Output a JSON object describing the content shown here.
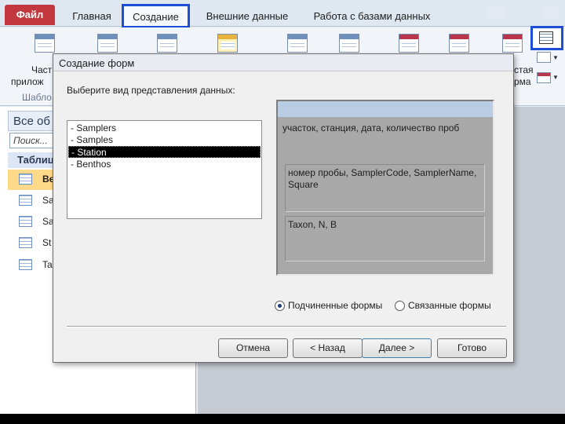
{
  "ribbon_tabs": {
    "file": "Файл",
    "home": "Главная",
    "create": "Создание",
    "external": "Внешние данные",
    "dbtools": "Работа с базами данных"
  },
  "ribbon": {
    "parts_line1": "Част",
    "parts_line2": "прилож",
    "templates_group": "Шабло",
    "right_label1": "стая",
    "right_label2": "рма"
  },
  "nav": {
    "header": "Все об",
    "search_placeholder": "Поиск...",
    "group": "Таблиц",
    "items": [
      {
        "label": "Be",
        "selected": true
      },
      {
        "label": "Sa",
        "selected": false
      },
      {
        "label": "Sa",
        "selected": false
      },
      {
        "label": "St",
        "selected": false
      },
      {
        "label": "Ta",
        "selected": false
      }
    ]
  },
  "dialog": {
    "title": "Создание форм",
    "prompt": "Выберите вид представления данных:",
    "list": [
      {
        "label": "- Samplers",
        "selected": false
      },
      {
        "label": "- Samples",
        "selected": false
      },
      {
        "label": "- Station",
        "selected": true
      },
      {
        "label": "- Benthos",
        "selected": false
      }
    ],
    "preview": {
      "main_fields": "участок, станция, дата, количество проб",
      "sub1_fields": "номер пробы, SamplerCode, SamplerName, Square",
      "sub2_fields": "Taxon, N, B"
    },
    "radio_subforms": {
      "label": "Подчиненные формы",
      "checked": true
    },
    "radio_linked": {
      "label": "Связанные формы",
      "checked": false
    },
    "buttons": {
      "cancel": "Отмена",
      "back": "< Назад",
      "next": "Далее >",
      "finish": "Готово"
    }
  },
  "colors": {
    "file_tab": "#c3383e",
    "highlight_border": "#1d4fd6",
    "nav_selected": "#ffd98a"
  }
}
